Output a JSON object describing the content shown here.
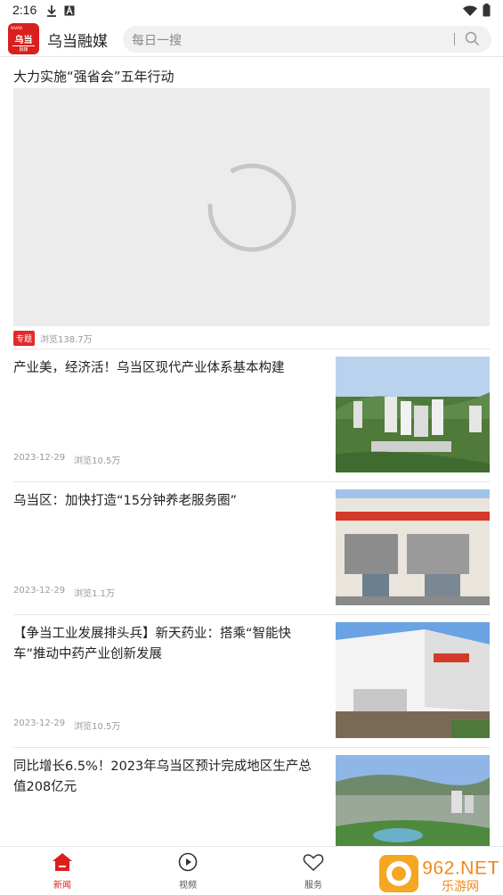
{
  "status_bar": {
    "time": "2:16",
    "left_icons": [
      "download-icon",
      "a-icon"
    ],
    "right_icons": [
      "wifi-icon",
      "battery-icon"
    ]
  },
  "header": {
    "logo_text": "乌当",
    "logo_small_top": "www",
    "logo_small_bottom": "融媒",
    "app_title": "乌当融媒",
    "search_placeholder": "每日一搜"
  },
  "featured": {
    "title": "大力实施“强省会”五年行动",
    "tag": "专题",
    "views": "浏览138.7万"
  },
  "news": [
    {
      "title": "产业美，经济活！乌当区现代产业体系基本构建",
      "date": "2023-12-29",
      "views": "浏览10.5万",
      "image": "city-aerial"
    },
    {
      "title": "乌当区：加快打造“15分钟养老服务圈”",
      "date": "2023-12-29",
      "views": "浏览1.1万",
      "image": "building-facade"
    },
    {
      "title": "【争当工业发展排头兵】新天药业：搭乘“智能快车”推动中药产业创新发展",
      "date": "2023-12-29",
      "views": "浏览10.5万",
      "image": "factory-building"
    },
    {
      "title": "同比增长6.5%！2023年乌当区预计完成地区生产总值208亿元",
      "date": "",
      "views": "",
      "image": "landscape-aerial"
    }
  ],
  "bottom_nav": [
    {
      "label": "新闻",
      "icon": "home-icon",
      "active": true
    },
    {
      "label": "视频",
      "icon": "play-icon",
      "active": false
    },
    {
      "label": "服务",
      "icon": "heart-icon",
      "active": false
    }
  ],
  "watermark": {
    "text": "962.NET",
    "sub": "乐游网"
  },
  "colors": {
    "accent": "#d9201e",
    "tag": "#e32a2a",
    "meta": "#999999"
  }
}
